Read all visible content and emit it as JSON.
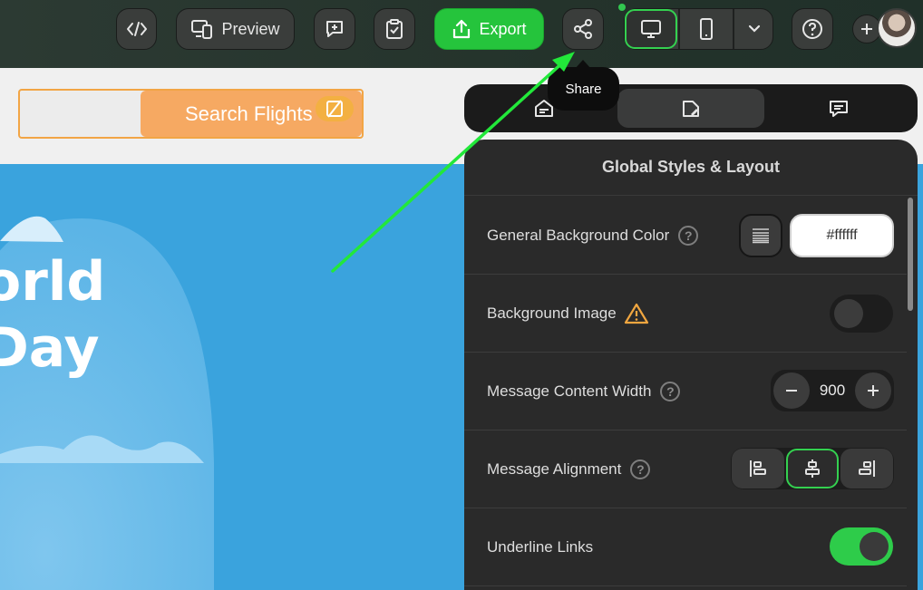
{
  "toolbar": {
    "code_icon": "code-icon",
    "preview_label": "Preview",
    "export_label": "Export",
    "share_tooltip": "Share",
    "export_color": "#25c43c"
  },
  "email": {
    "search_button_label": "Search Flights",
    "hero_line1": "orld",
    "hero_line2": "Day",
    "hero_bg_color": "#3aa3dd"
  },
  "panel": {
    "title": "Global Styles & Layout",
    "rows": {
      "bg_color_label": "General Background Color",
      "bg_color_value": "#ffffff",
      "bg_image_label": "Background Image",
      "bg_image_enabled": false,
      "content_width_label": "Message Content Width",
      "content_width_value": "900",
      "alignment_label": "Message Alignment",
      "alignment_selected": "center",
      "underline_label": "Underline Links",
      "underline_enabled": true
    },
    "accent_color": "#34d150"
  }
}
